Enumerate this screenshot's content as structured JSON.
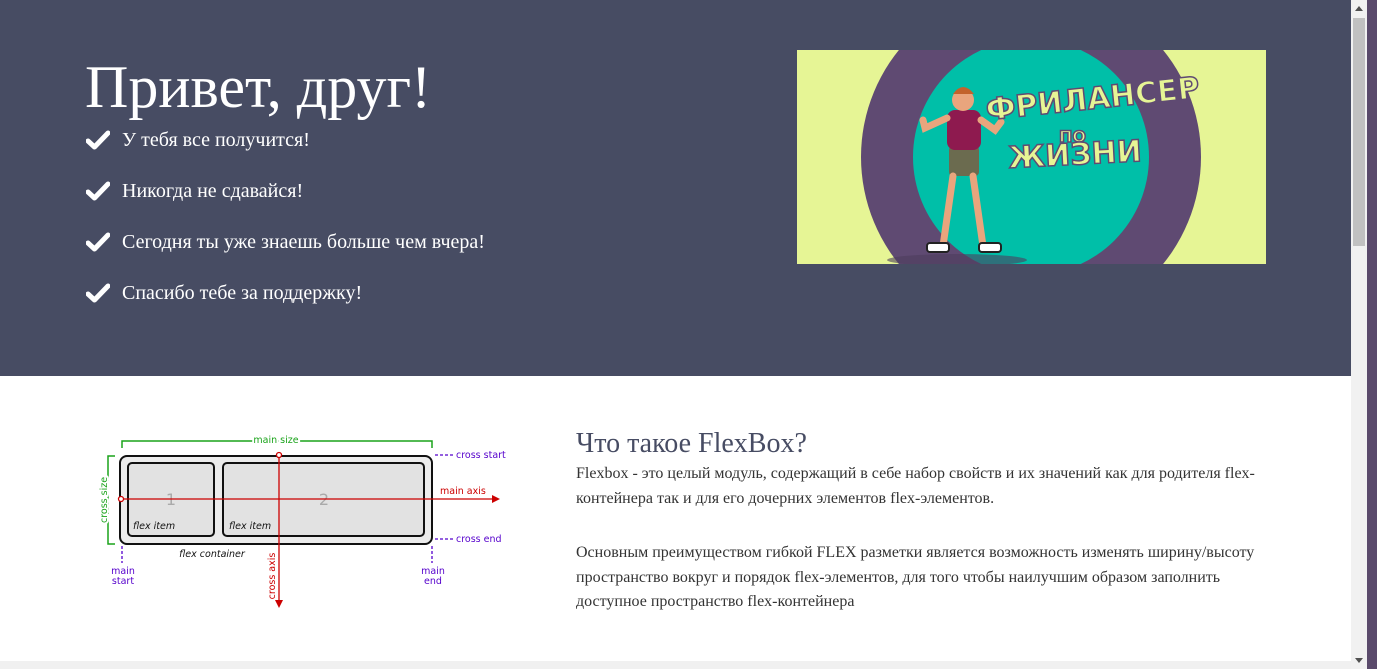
{
  "hero": {
    "title": "Привет, друг!",
    "items": [
      "У тебя все получится!",
      "Никогда не сдавайся!",
      "Сегодня ты уже знаешь больше чем вчера!",
      "Спасибо тебе за поддержку!"
    ],
    "banner_text_line1": "ФРИЛАНСЕР",
    "banner_text_line2": "ПО",
    "banner_text_line3": "ЖИЗНИ"
  },
  "diagram": {
    "main_size": "main size",
    "cross_start": "cross start",
    "main_axis": "main axis",
    "cross_size": "cross size",
    "item1_num": "1",
    "item2_num": "2",
    "flex_item1": "flex item",
    "flex_item2": "flex item",
    "cross_end": "cross end",
    "flex_container": "flex container",
    "main_start_1": "main",
    "main_start_2": "start",
    "cross_axis": "cross axis",
    "main_end_1": "main",
    "main_end_2": "end"
  },
  "section": {
    "title": "Что такое FlexBox?",
    "paragraph1": "Flexbox - это целый модуль, содержащий в себе набор свойств и их значений как для родителя flex-контейнера так и для его дочерних элементов flex-элементов.",
    "paragraph2": "Основным преимуществом гибкой FLEX разметки является возможность изменять ширину/высоту пространство вокруг и порядок flex-элементов, для того чтобы наилучшим образом заполнить доступное пространство flex-контейнера"
  },
  "colors": {
    "hero_bg": "#474c63",
    "banner_yellow": "#e6f595",
    "banner_purple": "#5f4a72",
    "banner_teal": "#00bfa8"
  }
}
